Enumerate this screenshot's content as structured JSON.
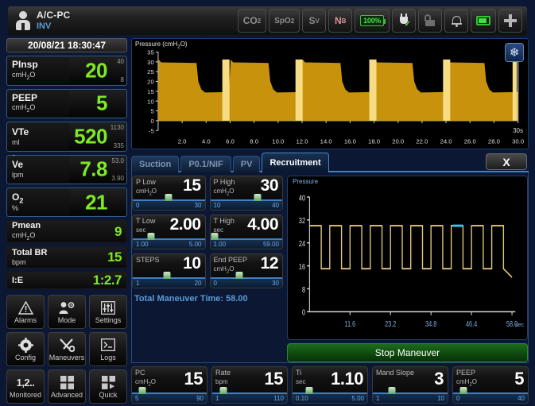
{
  "header": {
    "patient_icon": "person-icon",
    "mode": "A/C-PC",
    "ventilation_type": "INV",
    "icons": [
      {
        "name": "co2-indicator",
        "label": "CO",
        "sub": "2"
      },
      {
        "name": "spo2-indicator",
        "label": "SpO",
        "sub": "2"
      },
      {
        "name": "sv-indicator",
        "label": "S",
        "sub": "V"
      },
      {
        "name": "nb-indicator",
        "label": "N",
        "sub": "B"
      }
    ],
    "battery_percent": "100%",
    "power_icon": "plug-icon",
    "lock_icon": "lock-open-icon",
    "alarm_icon": "bell-icon",
    "battery_icon": "battery-icon",
    "add_icon": "plus-icon"
  },
  "clock": "20/08/21 18:30:47",
  "parameters": [
    {
      "name": "PInsp",
      "unit": "cmH",
      "unit_sub": "2",
      "unit_tail": "O",
      "value": "20",
      "high": "40",
      "low": "8",
      "boxed": true
    },
    {
      "name": "PEEP",
      "unit": "cmH",
      "unit_sub": "2",
      "unit_tail": "O",
      "value": "5",
      "high": "",
      "low": "",
      "boxed": true
    },
    {
      "name": "VTe",
      "unit": "ml",
      "unit_sub": "",
      "unit_tail": "",
      "value": "520",
      "high": "1130",
      "low": "335",
      "boxed": true
    },
    {
      "name": "Ve",
      "unit": "lpm",
      "unit_sub": "",
      "unit_tail": "",
      "value": "7.8",
      "high": "53.0",
      "low": "3.90",
      "boxed": true
    },
    {
      "name": "O",
      "unit": "%",
      "unit_sub": "",
      "unit_tail": "",
      "name_sub": "2",
      "value": "21",
      "high": "",
      "low": "",
      "boxed": true
    }
  ],
  "parameters_plain": [
    {
      "name": "Pmean",
      "unit": "cmH",
      "unit_sub": "2",
      "unit_tail": "O",
      "value": "9"
    },
    {
      "name": "Total BR",
      "unit": "bpm",
      "unit_sub": "",
      "unit_tail": "",
      "value": "15"
    },
    {
      "name": "I:E",
      "unit": "",
      "unit_sub": "",
      "unit_tail": "",
      "value": "1:2.7"
    }
  ],
  "buttons": [
    {
      "name": "alarms-button",
      "label": "Alarms",
      "icon": "warning-triangle-icon"
    },
    {
      "name": "mode-button",
      "label": "Mode",
      "icon": "person-gear-icon"
    },
    {
      "name": "settings-button",
      "label": "Settings",
      "icon": "sliders-icon"
    },
    {
      "name": "config-button",
      "label": "Config",
      "icon": "gear-icon"
    },
    {
      "name": "maneuvers-button",
      "label": "Maneuvers",
      "icon": "tools-icon"
    },
    {
      "name": "logs-button",
      "label": "Logs",
      "icon": "terminal-icon"
    },
    {
      "name": "monitored-button",
      "label": "Monitored",
      "icon": "numbers-icon"
    },
    {
      "name": "advanced-button",
      "label": "Advanced",
      "icon": "grid-icon"
    },
    {
      "name": "quick-button",
      "label": "Quick",
      "icon": "grid-play-icon"
    }
  ],
  "waveform": {
    "title": "Pressure (cmH",
    "title_sub": "2",
    "title_tail": "O)",
    "freeze_icon": "snowflake-icon",
    "time_label": "30s",
    "y_ticks": [
      "35",
      "30",
      "25",
      "20",
      "15",
      "10",
      "5",
      "0",
      "-5"
    ],
    "x_ticks": [
      "2.0",
      "4.0",
      "6.0",
      "8.0",
      "10.0",
      "12.0",
      "14.0",
      "16.0",
      "18.0",
      "20.0",
      "22.0",
      "24.0",
      "26.0",
      "28.0",
      "30.0"
    ],
    "fill_color": "#c8920c",
    "light_color": "#f6dd84"
  },
  "tabs": [
    {
      "name": "tab-suction",
      "label": "Suction",
      "active": false
    },
    {
      "name": "tab-p01nif",
      "label": "P0.1/NIF",
      "active": false
    },
    {
      "name": "tab-pv",
      "label": "PV",
      "active": false
    },
    {
      "name": "tab-recruitment",
      "label": "Recruitment",
      "active": true
    }
  ],
  "close_label": "X",
  "recruitment_controls": [
    {
      "name": "P Low",
      "unit": "cmH",
      "unit_sub": "2",
      "unit_tail": "O",
      "value": "15",
      "min": "0",
      "max": "30",
      "pct": 50
    },
    {
      "name": "P High",
      "unit": "cmH",
      "unit_sub": "2",
      "unit_tail": "O",
      "value": "30",
      "min": "10",
      "max": "40",
      "pct": 66
    },
    {
      "name": "T Low",
      "unit": "sec",
      "unit_sub": "",
      "unit_tail": "",
      "value": "2.00",
      "min": "1.00",
      "max": "5.00",
      "pct": 25
    },
    {
      "name": "T High",
      "unit": "sec",
      "unit_sub": "",
      "unit_tail": "",
      "value": "4.00",
      "min": "1.00",
      "max": "59.00",
      "pct": 6
    },
    {
      "name": "STEPS",
      "unit": "",
      "unit_sub": "",
      "unit_tail": "",
      "value": "10",
      "min": "1",
      "max": "20",
      "pct": 47
    },
    {
      "name": "End PEEP",
      "unit": "cmH",
      "unit_sub": "2",
      "unit_tail": "O",
      "value": "12",
      "min": "0",
      "max": "30",
      "pct": 40
    }
  ],
  "maneuver_time_label": "Total Maneuver Time: 58.00",
  "recruit_chart": {
    "title": "Pressure",
    "sec_label": "sec",
    "y_ticks": [
      "40",
      "32",
      "24",
      "16",
      "8",
      "0"
    ],
    "x_ticks": [
      "11.6",
      "23.2",
      "34.8",
      "46.4",
      "58.0"
    ],
    "ylim": [
      0,
      40
    ],
    "xlim": [
      0,
      58
    ],
    "p_high": 30,
    "p_low": 15,
    "n_steps": 10,
    "highlight_step": 8,
    "trace_color": "#e3c878",
    "highlight_color": "#35c6f4"
  },
  "stop_button_label": "Stop Maneuver",
  "bottom_controls": [
    {
      "name": "PC",
      "unit": "cmH",
      "unit_sub": "2",
      "unit_tail": "O",
      "value": "15",
      "min": "5",
      "max": "90",
      "pct": 14
    },
    {
      "name": "Rate",
      "unit": "bpm",
      "unit_sub": "",
      "unit_tail": "",
      "value": "15",
      "min": "1",
      "max": "110",
      "pct": 15
    },
    {
      "name": "Ti",
      "unit": "sec",
      "unit_sub": "",
      "unit_tail": "",
      "value": "1.10",
      "min": "0.10",
      "max": "5.00",
      "pct": 22
    },
    {
      "name": "Mand Slope",
      "unit": "",
      "unit_sub": "",
      "unit_tail": "",
      "value": "3",
      "min": "1",
      "max": "10",
      "pct": 26
    },
    {
      "name": "PEEP",
      "unit": "cmH",
      "unit_sub": "2",
      "unit_tail": "O",
      "value": "5",
      "min": "0",
      "max": "40",
      "pct": 14
    }
  ],
  "chart_data": [
    {
      "type": "area",
      "title": "Pressure (cmH2O)",
      "xlabel": "time (s)",
      "ylabel": "Pressure (cmH2O)",
      "ylim": [
        -5,
        35
      ],
      "xlim": [
        0,
        30
      ],
      "y_ticks": [
        35,
        30,
        25,
        20,
        15,
        10,
        5,
        0,
        -5
      ],
      "x_ticks": [
        2,
        4,
        6,
        8,
        10,
        12,
        14,
        16,
        18,
        20,
        22,
        24,
        26,
        28,
        30
      ],
      "grid": false,
      "series": [
        {
          "name": "Airway pressure",
          "description": "Square inspiratory plateaus ~30 cmH2O alternating with PEEP ~15 cmH2O, period ~6s",
          "plateau_high": 30,
          "plateau_low": 15,
          "cycle_period": 6,
          "n_cycles": 5
        }
      ]
    },
    {
      "type": "line",
      "title": "Pressure",
      "xlabel": "sec",
      "ylabel": "Pressure",
      "ylim": [
        0,
        40
      ],
      "xlim": [
        0,
        58
      ],
      "y_ticks": [
        0,
        8,
        16,
        24,
        32,
        40
      ],
      "x_ticks": [
        11.6,
        23.2,
        34.8,
        46.4,
        58.0
      ],
      "grid": false,
      "series": [
        {
          "name": "Recruitment maneuver",
          "description": "10 square pulses between P Low 15 and P High 30; step 8 highlighted cyan (current step)",
          "values": [
            30,
            15,
            30,
            15,
            30,
            15,
            30,
            15,
            30,
            15,
            30,
            15,
            30,
            15,
            30,
            15,
            30,
            15,
            30,
            12
          ]
        }
      ]
    }
  ]
}
